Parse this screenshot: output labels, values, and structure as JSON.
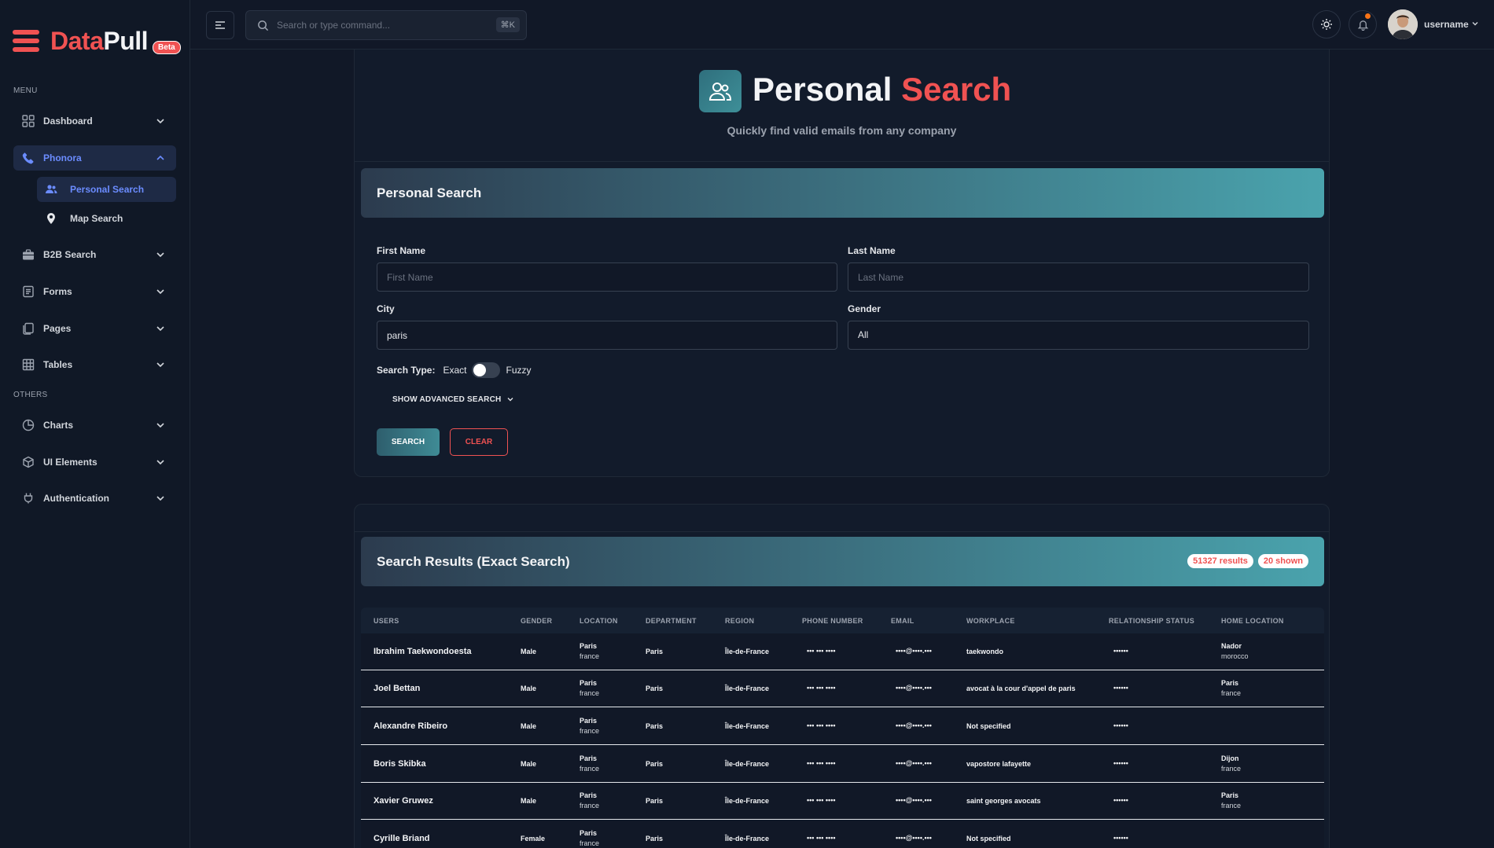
{
  "brand": {
    "part1": "Data",
    "part2": "Pull",
    "badge": "Beta"
  },
  "sidebar": {
    "menu_heading": "MENU",
    "others_heading": "OTHERS",
    "items": [
      {
        "label": "Dashboard",
        "icon": "grid-icon"
      },
      {
        "label": "Phonora",
        "icon": "phone-icon"
      },
      {
        "label": "B2B Search",
        "icon": "briefcase-icon"
      },
      {
        "label": "Forms",
        "icon": "form-icon"
      },
      {
        "label": "Pages",
        "icon": "pages-icon"
      },
      {
        "label": "Tables",
        "icon": "table-icon"
      },
      {
        "label": "Charts",
        "icon": "pie-chart-icon"
      },
      {
        "label": "UI Elements",
        "icon": "cube-icon"
      },
      {
        "label": "Authentication",
        "icon": "plug-icon"
      }
    ],
    "sub_items": [
      {
        "label": "Personal Search",
        "icon": "users-icon"
      },
      {
        "label": "Map Search",
        "icon": "map-pin-icon"
      }
    ]
  },
  "topbar": {
    "search_placeholder": "Search or type command...",
    "shortcut": "⌘K",
    "username": "username"
  },
  "hero": {
    "title_white": "Personal",
    "title_red": "Search",
    "subtitle": "Quickly find valid emails from any company"
  },
  "form": {
    "banner": "Personal Search",
    "first_name_label": "First Name",
    "first_name_placeholder": "First Name",
    "last_name_label": "Last Name",
    "last_name_placeholder": "Last Name",
    "city_label": "City",
    "city_value": "paris",
    "gender_label": "Gender",
    "gender_value": "All",
    "search_type_label": "Search Type:",
    "exact_label": "Exact",
    "fuzzy_label": "Fuzzy",
    "advanced_label": "SHOW ADVANCED SEARCH",
    "search_button": "SEARCH",
    "clear_button": "CLEAR"
  },
  "results": {
    "title": "Search Results (Exact Search)",
    "count_badge": "51327 results",
    "shown_badge": "20 shown",
    "columns": [
      "USERS",
      "GENDER",
      "LOCATION",
      "DEPARTMENT",
      "REGION",
      "PHONE NUMBER",
      "EMAIL",
      "WORKPLACE",
      "RELATIONSHIP STATUS",
      "HOME LOCATION"
    ],
    "rows": [
      {
        "user": "Ibrahim Taekwondoesta",
        "gender": "Male",
        "loc1": "Paris",
        "loc2": "france",
        "department": "Paris",
        "region": "Île-de-France",
        "phone": "••• ••• ••••",
        "email": "••••@••••.•••",
        "workplace": "taekwondo",
        "relationship": "••••••",
        "home1": "Nador",
        "home2": "morocco"
      },
      {
        "user": "Joel Bettan",
        "gender": "Male",
        "loc1": "Paris",
        "loc2": "france",
        "department": "Paris",
        "region": "Île-de-France",
        "phone": "••• ••• ••••",
        "email": "••••@••••.•••",
        "workplace": "avocat à la cour d'appel de paris",
        "relationship": "••••••",
        "home1": "Paris",
        "home2": "france"
      },
      {
        "user": "Alexandre Ribeiro",
        "gender": "Male",
        "loc1": "Paris",
        "loc2": "france",
        "department": "Paris",
        "region": "Île-de-France",
        "phone": "••• ••• ••••",
        "email": "••••@••••.•••",
        "workplace": "Not specified",
        "relationship": "••••••",
        "home1": "",
        "home2": ""
      },
      {
        "user": "Boris Skibka",
        "gender": "Male",
        "loc1": "Paris",
        "loc2": "france",
        "department": "Paris",
        "region": "Île-de-France",
        "phone": "••• ••• ••••",
        "email": "••••@••••.•••",
        "workplace": "vapostore lafayette",
        "relationship": "••••••",
        "home1": "Dijon",
        "home2": "france"
      },
      {
        "user": "Xavier Gruwez",
        "gender": "Male",
        "loc1": "Paris",
        "loc2": "france",
        "department": "Paris",
        "region": "Île-de-France",
        "phone": "••• ••• ••••",
        "email": "••••@••••.•••",
        "workplace": "saint georges avocats",
        "relationship": "••••••",
        "home1": "Paris",
        "home2": "france"
      },
      {
        "user": "Cyrille Briand",
        "gender": "Female",
        "loc1": "Paris",
        "loc2": "france",
        "department": "Paris",
        "region": "Île-de-France",
        "phone": "••• ••• ••••",
        "email": "••••@••••.•••",
        "workplace": "Not specified",
        "relationship": "••••••",
        "home1": "",
        "home2": ""
      }
    ]
  },
  "colors": {
    "accent_red": "#f05252",
    "accent_blue": "#6b8cff",
    "teal": "#4aa3ad"
  }
}
